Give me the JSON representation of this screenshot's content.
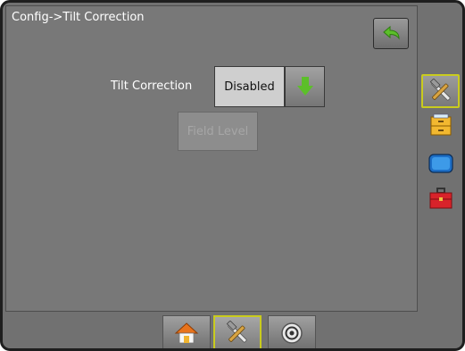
{
  "title": "Config->Tilt Correction",
  "tilt_correction": {
    "label": "Tilt Correction",
    "value": "Disabled"
  },
  "field_level_label": "Field Level",
  "side_tabs": [
    {
      "icon": "tools-icon",
      "active": true
    },
    {
      "icon": "file-cabinet-icon",
      "active": false
    },
    {
      "icon": "display-screen-icon",
      "active": false
    },
    {
      "icon": "toolbox-icon",
      "active": false
    }
  ],
  "bottom_tabs": [
    {
      "icon": "home-icon",
      "active": false
    },
    {
      "icon": "tools-icon",
      "active": true
    },
    {
      "icon": "gauge-icon",
      "active": false
    }
  ],
  "colors": {
    "background": "#717171",
    "active_border": "#c9cb1e",
    "arrow_green": "#5cbf2a"
  }
}
